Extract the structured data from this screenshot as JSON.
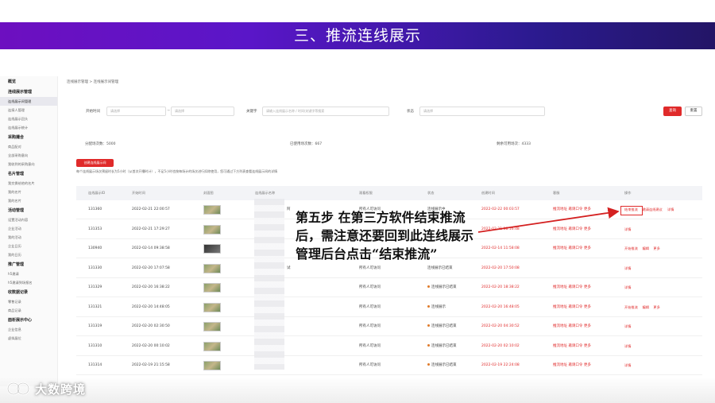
{
  "banner": {
    "title": "三、推流连线展示"
  },
  "sidebar": {
    "items": [
      {
        "type": "sec",
        "label": "概览"
      },
      {
        "type": "sec",
        "label": "连线展示管理"
      },
      {
        "type": "it",
        "label": "连线展示间管理",
        "active": true
      },
      {
        "type": "it",
        "label": "连接人管理"
      },
      {
        "type": "it",
        "label": "连线展示回头"
      },
      {
        "type": "it",
        "label": "连线展示统计"
      },
      {
        "type": "sec",
        "label": "采购撮合"
      },
      {
        "type": "it",
        "label": "商品配对"
      },
      {
        "type": "it",
        "label": "全部采购意向"
      },
      {
        "type": "it",
        "label": "我收到的采购意向"
      },
      {
        "type": "sec",
        "label": "名片管理"
      },
      {
        "type": "it",
        "label": "我交换给他的名片"
      },
      {
        "type": "it",
        "label": "我的名片"
      },
      {
        "type": "it",
        "label": "我的名片"
      },
      {
        "type": "sec",
        "label": "活动管理"
      },
      {
        "type": "it",
        "label": "设置活动内容"
      },
      {
        "type": "it",
        "label": "企业活动"
      },
      {
        "type": "it",
        "label": "我的活动"
      },
      {
        "type": "it",
        "label": "企业日历"
      },
      {
        "type": "it",
        "label": "我的日历"
      },
      {
        "type": "sec",
        "label": "推广管理"
      },
      {
        "type": "it",
        "label": "h5邀请"
      },
      {
        "type": "it",
        "label": "h5邀请到场报名"
      },
      {
        "type": "sec",
        "label": "收数据记录"
      },
      {
        "type": "it",
        "label": "零售记录"
      },
      {
        "type": "it",
        "label": "商品记录"
      },
      {
        "type": "sec",
        "label": "面析展示中心"
      },
      {
        "type": "it",
        "label": "企业信息"
      },
      {
        "type": "it",
        "label": "虚拟展位"
      }
    ]
  },
  "breadcrumb": "连线展示管理 > 连线展示间管理",
  "filters": {
    "start_time_label": "开始时间",
    "start_placeholder": "请选择",
    "end_placeholder": "请选择",
    "keyword_label": "关键字",
    "keyword_placeholder": "请输入连线展示名称 / 时间/关键字等搜索",
    "status_label": "状态",
    "status_placeholder": "请选择",
    "query_label": "查询",
    "reset_label": "重置"
  },
  "stats": {
    "total": "分配场次数：5000",
    "used": "已使用场次数：667",
    "remaining": "剩余可用场次：4333"
  },
  "create_button": "创建连线展示间",
  "notice": "每个连线展示场次预留时长为5小时（从首次开播时计），不足5小时也按每场计的场次进行扣除使用，您可通过下方列表查看连线展示间的详情",
  "table": {
    "headers": [
      "连线展示ID",
      "开始时间",
      "封面图",
      "连线展示名称",
      "观看权限",
      "状态",
      "创建时间",
      "客服",
      "操作"
    ],
    "rows": [
      {
        "id": "131360",
        "start": "2022-02-21 22:00:57",
        "name": "阿",
        "perm": "所有人可访问",
        "status": "连线展示中",
        "status_dot": false,
        "created": "2022-02-22 00:03:57",
        "service": "推流地址  邀请口令  更多",
        "ops": [
          "结束推流",
          "邀请连线建议",
          "详情"
        ],
        "thumb": "light"
      },
      {
        "id": "131353",
        "start": "2022-02-21 17:29:27",
        "name": "",
        "perm": "",
        "status": "",
        "status_dot": false,
        "created": "2022-02-21 18:16:48",
        "service": "推流地址  邀请口令  更多",
        "ops": [
          "详情"
        ],
        "thumb": "light"
      },
      {
        "id": "130940",
        "start": "2022-02-14 09:38:58",
        "name": "",
        "perm": "",
        "status": "",
        "status_dot": false,
        "created": "2022-02-14 11:58:08",
        "service": "推流地址  邀请口令  更多",
        "ops": [
          "开始推流",
          "编辑",
          "更多"
        ],
        "thumb": "dark"
      },
      {
        "id": "131330",
        "start": "2022-02-20 17:07:58",
        "name": "试",
        "perm": "所有人可访问",
        "status": "连线展示已结束",
        "status_dot": false,
        "created": "2022-02-20 17:50:08",
        "service": "",
        "ops": [
          "详情"
        ],
        "thumb": "light"
      },
      {
        "id": "131329",
        "start": "2022-02-20 16:38:22",
        "name": "",
        "perm": "所有人可访问",
        "status": "连线展示已结束",
        "status_dot": true,
        "created": "2022-02-20 18:38:22",
        "service": "推流地址  邀请口令  更多",
        "ops": [
          "详情"
        ],
        "thumb": "light"
      },
      {
        "id": "131321",
        "start": "2022-02-20 14:48:05",
        "name": "",
        "perm": "所有人可访问",
        "status": "连线展示",
        "status_dot": true,
        "created": "2022-02-20 16:48:05",
        "service": "推流地址  邀请口令  更多",
        "ops": [
          "开始推流",
          "编辑",
          "更多"
        ],
        "thumb": "light"
      },
      {
        "id": "131319",
        "start": "2022-02-20 02:30:50",
        "name": "",
        "perm": "所有人可访问",
        "status": "连线展示已结束",
        "status_dot": true,
        "created": "2022-02-20 04:30:52",
        "service": "推流地址  邀请口令  更多",
        "ops": [
          "详情"
        ],
        "thumb": "light"
      },
      {
        "id": "131310",
        "start": "2022-02-20 00:10:02",
        "name": "",
        "perm": "所有人可访问",
        "status": "连线展示已结束",
        "status_dot": true,
        "created": "2022-02-20 02:10:02",
        "service": "推流地址  邀请口令  更多",
        "ops": [
          "详情"
        ],
        "thumb": "light"
      },
      {
        "id": "131314",
        "start": "2022-02-19 21:15:58",
        "name": "",
        "perm": "所有人可访问",
        "status": "连线展示已结束",
        "status_dot": true,
        "created": "2022-02-19 22:24:08",
        "service": "推流地址  邀请口令  更多",
        "ops": [
          "详情"
        ],
        "thumb": "light"
      }
    ]
  },
  "callout": {
    "line1": "第五步  在第三方软件结束推流",
    "line2": "后，需注意还要回到此连线展示",
    "line3": "管理后台点击“结束推流”"
  },
  "footer": {
    "logo_text": "大数跨境"
  },
  "colors": {
    "accent": "#e02a2a",
    "banner_start": "#6d0fc0",
    "banner_end": "#231566"
  }
}
